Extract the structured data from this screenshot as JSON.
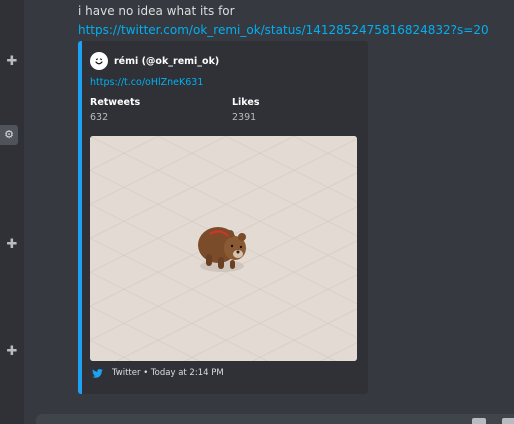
{
  "message": {
    "text": "i have no idea what its for",
    "link": "https://twitter.com/ok_remi_ok/status/1412852475816824832?s=20"
  },
  "embed": {
    "accent_color": "#1da1f2",
    "author": "rémi (@ok_remi_ok)",
    "tweet_link": "https://t.co/oHlZneK631",
    "fields": [
      {
        "name": "Retweets",
        "value": "632"
      },
      {
        "name": "Likes",
        "value": "2391"
      }
    ],
    "footer": {
      "icon": "twitter-bird-icon",
      "text": "Twitter • Today at 2:14 PM"
    }
  },
  "rail": {
    "icons": [
      "plus-icon",
      "gear-icon",
      "plus-icon",
      "plus-icon"
    ]
  },
  "colors": {
    "link": "#00b0f4",
    "background": "#36393f",
    "embed_background": "#2f3136"
  }
}
